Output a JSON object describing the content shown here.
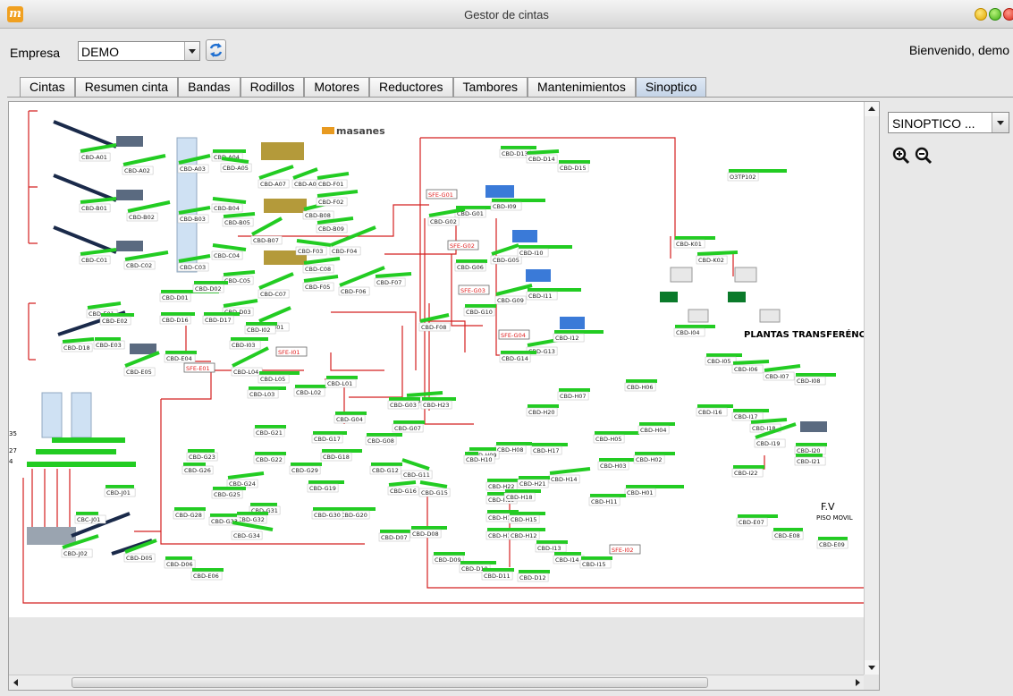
{
  "window": {
    "title": "Gestor de cintas",
    "app_icon": "m"
  },
  "toolbar": {
    "empresa_label": "Empresa",
    "empresa_value": "DEMO",
    "welcome": "Bienvenido, demo"
  },
  "tabs": [
    {
      "label": "Cintas"
    },
    {
      "label": "Resumen cinta"
    },
    {
      "label": "Bandas"
    },
    {
      "label": "Rodillos"
    },
    {
      "label": "Motores"
    },
    {
      "label": "Reductores"
    },
    {
      "label": "Tambores"
    },
    {
      "label": "Mantenimientos"
    },
    {
      "label": "Sinoptico",
      "active": true
    }
  ],
  "side": {
    "selector_value": "SINOPTICO ...",
    "zoom_in": "zoom-in-icon",
    "zoom_out": "zoom-out-icon"
  },
  "colors": {
    "belt": "#22cc22",
    "line": "#d42020",
    "alarm": "#e02020",
    "tab_active": "#c3d3e6"
  },
  "diagram": {
    "logo": "masanes",
    "belts": [
      {
        "label": "CBD-A01"
      },
      {
        "label": "CBD-A02"
      },
      {
        "label": "CBD-A03"
      },
      {
        "label": "CBD-A04"
      },
      {
        "label": "CBD-A05"
      },
      {
        "label": "CBD-A07"
      },
      {
        "label": "CBD-A08"
      },
      {
        "label": "CBD-B01"
      },
      {
        "label": "CBD-B02"
      },
      {
        "label": "CBD-B03"
      },
      {
        "label": "CBD-B04"
      },
      {
        "label": "CBD-B05"
      },
      {
        "label": "CBD-B07"
      },
      {
        "label": "CBD-B08"
      },
      {
        "label": "CBD-B09"
      },
      {
        "label": "CBD-C01"
      },
      {
        "label": "CBD-C02"
      },
      {
        "label": "CBD-C03"
      },
      {
        "label": "CBD-C04"
      },
      {
        "label": "CBD-C05"
      },
      {
        "label": "CBD-C07"
      },
      {
        "label": "CBD-C08"
      },
      {
        "label": "CBD-F01"
      },
      {
        "label": "CBD-F02"
      },
      {
        "label": "CBD-F03"
      },
      {
        "label": "CBD-F04"
      },
      {
        "label": "CBD-F05"
      },
      {
        "label": "CBD-F06"
      },
      {
        "label": "CBD-F07"
      },
      {
        "label": "CBD-F08"
      },
      {
        "label": "CBD-D01"
      },
      {
        "label": "CBD-D02"
      },
      {
        "label": "CBD-D03"
      },
      {
        "label": "CBD-D16"
      },
      {
        "label": "CBD-D17"
      },
      {
        "label": "CBD-E01"
      },
      {
        "label": "CBD-E02"
      },
      {
        "label": "CBD-E03"
      },
      {
        "label": "CBD-E04"
      },
      {
        "label": "CBD-E05"
      },
      {
        "label": "CBD-D18"
      },
      {
        "label": "CBD-I01"
      },
      {
        "label": "CBD-I02"
      },
      {
        "label": "CBD-I03"
      },
      {
        "label": "CBD-L04"
      },
      {
        "label": "CBD-L05"
      },
      {
        "label": "CBD-L02"
      },
      {
        "label": "CBD-L01"
      },
      {
        "label": "CBD-L03"
      },
      {
        "label": "CBD-D13"
      },
      {
        "label": "CBD-D14"
      },
      {
        "label": "CBD-D15"
      },
      {
        "label": "O3TP102"
      },
      {
        "label": "CBD-G01"
      },
      {
        "label": "CBD-G02"
      },
      {
        "label": "CBD-G05"
      },
      {
        "label": "CBD-G06"
      },
      {
        "label": "CBD-G09"
      },
      {
        "label": "CBD-G10"
      },
      {
        "label": "CBD-G13"
      },
      {
        "label": "CBD-G14"
      },
      {
        "label": "CBD-I09"
      },
      {
        "label": "CBD-I10"
      },
      {
        "label": "CBD-I11"
      },
      {
        "label": "CBD-I12"
      },
      {
        "label": "CBD-K01"
      },
      {
        "label": "CBD-K02"
      },
      {
        "label": "CBD-H24"
      },
      {
        "label": "CBD-H23"
      },
      {
        "label": "CBD-H20"
      },
      {
        "label": "CBD-H07"
      },
      {
        "label": "CBD-H06"
      },
      {
        "label": "CBD-H08"
      },
      {
        "label": "CBD-H09"
      },
      {
        "label": "CBD-H10"
      },
      {
        "label": "CBD-H17"
      },
      {
        "label": "CBD-H05"
      },
      {
        "label": "CBD-H04"
      },
      {
        "label": "CBD-H03"
      },
      {
        "label": "CBD-H02"
      },
      {
        "label": "CBD-H14"
      },
      {
        "label": "CBD-H01"
      },
      {
        "label": "CBD-H11"
      },
      {
        "label": "CBD-H22"
      },
      {
        "label": "CBD-H21"
      },
      {
        "label": "CBD-H19"
      },
      {
        "label": "CBD-H18"
      },
      {
        "label": "CBD-H16"
      },
      {
        "label": "CBD-H15"
      },
      {
        "label": "CBD-H13"
      },
      {
        "label": "CBD-H12"
      },
      {
        "label": "CBD-I04"
      },
      {
        "label": "CBD-I05"
      },
      {
        "label": "CBD-I06"
      },
      {
        "label": "CBD-I07"
      },
      {
        "label": "CBD-I08"
      },
      {
        "label": "CBD-I16"
      },
      {
        "label": "CBD-I17"
      },
      {
        "label": "CBD-I18"
      },
      {
        "label": "CBD-I19"
      },
      {
        "label": "CBD-I20"
      },
      {
        "label": "CBD-I21"
      },
      {
        "label": "CBD-I22"
      },
      {
        "label": "CBD-G03"
      },
      {
        "label": "CBD-G04"
      },
      {
        "label": "CBD-G07"
      },
      {
        "label": "CBD-G08"
      },
      {
        "label": "CBD-G11"
      },
      {
        "label": "CBD-G12"
      },
      {
        "label": "CBD-G15"
      },
      {
        "label": "CBD-G16"
      },
      {
        "label": "CBD-G17"
      },
      {
        "label": "CBD-G18"
      },
      {
        "label": "CBD-G19"
      },
      {
        "label": "CBD-G20"
      },
      {
        "label": "CBD-G21"
      },
      {
        "label": "CBD-G22"
      },
      {
        "label": "CBD-G23"
      },
      {
        "label": "CBD-G24"
      },
      {
        "label": "CBD-G25"
      },
      {
        "label": "CBD-G26"
      },
      {
        "label": "CBD-G28"
      },
      {
        "label": "CBD-G29"
      },
      {
        "label": "CBD-G30"
      },
      {
        "label": "CBD-G31"
      },
      {
        "label": "CBD-G32"
      },
      {
        "label": "CBD-G33"
      },
      {
        "label": "CBD-G34"
      },
      {
        "label": "CBD-J01"
      },
      {
        "label": "CBC-J01"
      },
      {
        "label": "CBD-J02"
      },
      {
        "label": "CBD-D05"
      },
      {
        "label": "CBD-D06"
      },
      {
        "label": "CBD-E06"
      },
      {
        "label": "CBD-D07"
      },
      {
        "label": "CBD-D08"
      },
      {
        "label": "CBD-D09"
      },
      {
        "label": "CBD-D10"
      },
      {
        "label": "CBD-D11"
      },
      {
        "label": "CBD-D12"
      },
      {
        "label": "CBD-E07"
      },
      {
        "label": "CBD-E08"
      },
      {
        "label": "CBD-E09"
      },
      {
        "label": "CBD-I13"
      },
      {
        "label": "CBD-I14"
      },
      {
        "label": "CBD-I15"
      }
    ],
    "alarms": [
      {
        "label": "SFE-G01"
      },
      {
        "label": "SFE-G02"
      },
      {
        "label": "SFE-G03"
      },
      {
        "label": "SFE-G04"
      },
      {
        "label": "SFE-E01"
      },
      {
        "label": "SFE-I01"
      },
      {
        "label": "SFE-I02"
      }
    ],
    "notes": {
      "plantas": "PLANTAS TRANSFERÉNCIA",
      "fv": "F.V",
      "piso": "PISO MOVIL",
      "n35": "35",
      "n27": "27",
      "n4": "4"
    }
  }
}
